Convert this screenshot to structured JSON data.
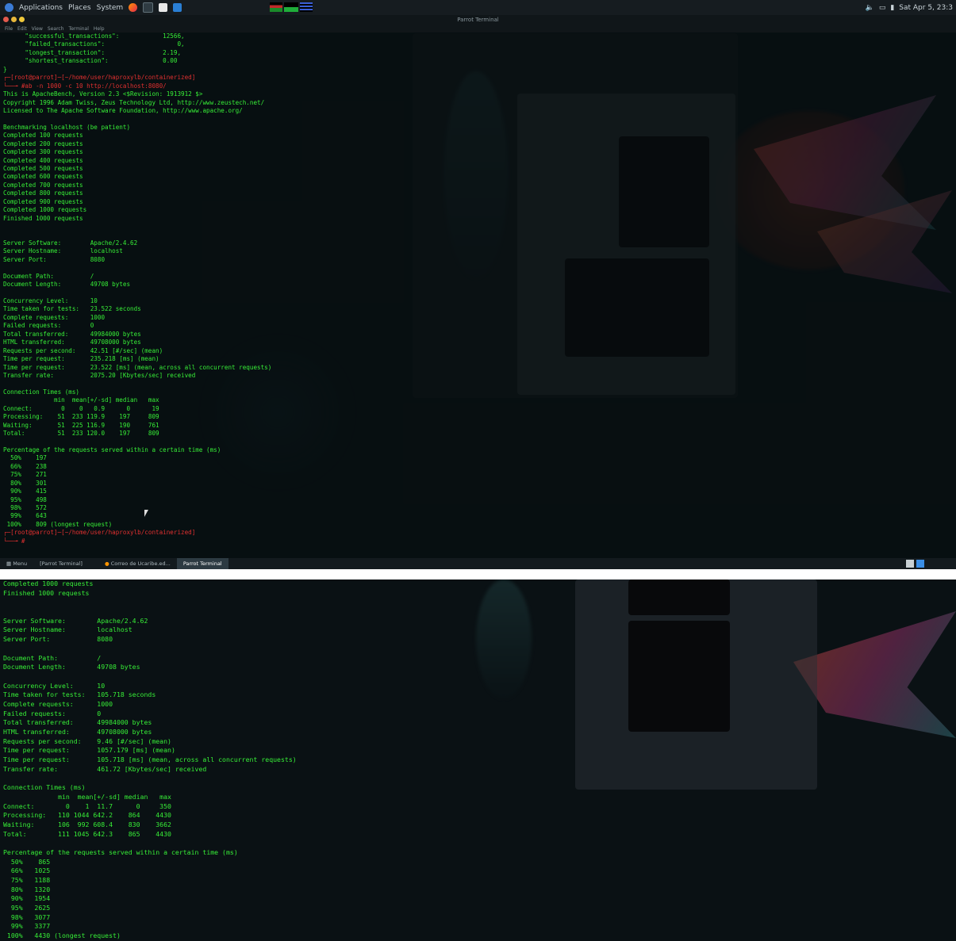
{
  "top_panel": {
    "menu": [
      "Applications",
      "Places",
      "System"
    ],
    "clock": "Sat Apr 5, 23:3"
  },
  "terminal": {
    "title": "Parrot Terminal",
    "menu": [
      "File",
      "Edit",
      "View",
      "Search",
      "Terminal",
      "Help"
    ],
    "lines": [
      {
        "t": "      \"successful_transactions\":            12566,"
      },
      {
        "t": "      \"failed_transactions\":                    0,"
      },
      {
        "t": "      \"longest_transaction\":                2.19,"
      },
      {
        "t": "      \"shortest_transaction\":               0.00"
      },
      {
        "t": "}"
      },
      {
        "t": "┌─[root@parrot]─[~/home/user/haproxylb/containerized]",
        "c": "prompt"
      },
      {
        "t": "└──╼ #ab -n 1000 -c 10 http://localhost:8080/",
        "c": "prompt"
      },
      {
        "t": "This is ApacheBench, Version 2.3 <$Revision: 1913912 $>"
      },
      {
        "t": "Copyright 1996 Adam Twiss, Zeus Technology Ltd, http://www.zeustech.net/"
      },
      {
        "t": "Licensed to The Apache Software Foundation, http://www.apache.org/"
      },
      {
        "t": ""
      },
      {
        "t": "Benchmarking localhost (be patient)"
      },
      {
        "t": "Completed 100 requests"
      },
      {
        "t": "Completed 200 requests"
      },
      {
        "t": "Completed 300 requests"
      },
      {
        "t": "Completed 400 requests"
      },
      {
        "t": "Completed 500 requests"
      },
      {
        "t": "Completed 600 requests"
      },
      {
        "t": "Completed 700 requests"
      },
      {
        "t": "Completed 800 requests"
      },
      {
        "t": "Completed 900 requests"
      },
      {
        "t": "Completed 1000 requests"
      },
      {
        "t": "Finished 1000 requests"
      },
      {
        "t": ""
      },
      {
        "t": ""
      },
      {
        "t": "Server Software:        Apache/2.4.62"
      },
      {
        "t": "Server Hostname:        localhost"
      },
      {
        "t": "Server Port:            8080"
      },
      {
        "t": ""
      },
      {
        "t": "Document Path:          /"
      },
      {
        "t": "Document Length:        49708 bytes"
      },
      {
        "t": ""
      },
      {
        "t": "Concurrency Level:      10"
      },
      {
        "t": "Time taken for tests:   23.522 seconds"
      },
      {
        "t": "Complete requests:      1000"
      },
      {
        "t": "Failed requests:        0"
      },
      {
        "t": "Total transferred:      49984000 bytes"
      },
      {
        "t": "HTML transferred:       49708000 bytes"
      },
      {
        "t": "Requests per second:    42.51 [#/sec] (mean)"
      },
      {
        "t": "Time per request:       235.218 [ms] (mean)"
      },
      {
        "t": "Time per request:       23.522 [ms] (mean, across all concurrent requests)"
      },
      {
        "t": "Transfer rate:          2075.20 [Kbytes/sec] received"
      },
      {
        "t": ""
      },
      {
        "t": "Connection Times (ms)"
      },
      {
        "t": "              min  mean[+/-sd] median   max"
      },
      {
        "t": "Connect:        0    0   0.9      0      19"
      },
      {
        "t": "Processing:    51  233 119.9    197     809"
      },
      {
        "t": "Waiting:       51  225 116.9    190     761"
      },
      {
        "t": "Total:         51  233 120.0    197     809"
      },
      {
        "t": ""
      },
      {
        "t": "Percentage of the requests served within a certain time (ms)"
      },
      {
        "t": "  50%    197"
      },
      {
        "t": "  66%    238"
      },
      {
        "t": "  75%    271"
      },
      {
        "t": "  80%    301"
      },
      {
        "t": "  90%    415"
      },
      {
        "t": "  95%    498"
      },
      {
        "t": "  98%    572"
      },
      {
        "t": "  99%    643"
      },
      {
        "t": " 100%    809 (longest request)"
      },
      {
        "t": "┌─[root@parrot]─[~/home/user/haproxylb/containerized]",
        "c": "prompt"
      },
      {
        "t": "└──╼ #",
        "c": "prompt"
      }
    ]
  },
  "taskbar": {
    "menu": "Menu",
    "items": [
      "[Parrot Terminal]",
      "Correo de Ucaribe.ed...",
      "Parrot Terminal"
    ]
  },
  "second_capture": {
    "lines": [
      "Completed 1000 requests",
      "Finished 1000 requests",
      "",
      "",
      "Server Software:        Apache/2.4.62",
      "Server Hostname:        localhost",
      "Server Port:            8080",
      "",
      "Document Path:          /",
      "Document Length:        49708 bytes",
      "",
      "Concurrency Level:      10",
      "Time taken for tests:   105.718 seconds",
      "Complete requests:      1000",
      "Failed requests:        0",
      "Total transferred:      49984000 bytes",
      "HTML transferred:       49708000 bytes",
      "Requests per second:    9.46 [#/sec] (mean)",
      "Time per request:       1057.179 [ms] (mean)",
      "Time per request:       105.718 [ms] (mean, across all concurrent requests)",
      "Transfer rate:          461.72 [Kbytes/sec] received",
      "",
      "Connection Times (ms)",
      "              min  mean[+/-sd] median   max",
      "Connect:        0    1  11.7      0     350",
      "Processing:   110 1044 642.2    864    4430",
      "Waiting:      106  992 608.4    830    3662",
      "Total:        111 1045 642.3    865    4430",
      "",
      "Percentage of the requests served within a certain time (ms)",
      "  50%    865",
      "  66%   1025",
      "  75%   1188",
      "  80%   1320",
      "  90%   1954",
      "  95%   2625",
      "  98%   3077",
      "  99%   3377",
      " 100%   4430 (longest request)"
    ]
  }
}
